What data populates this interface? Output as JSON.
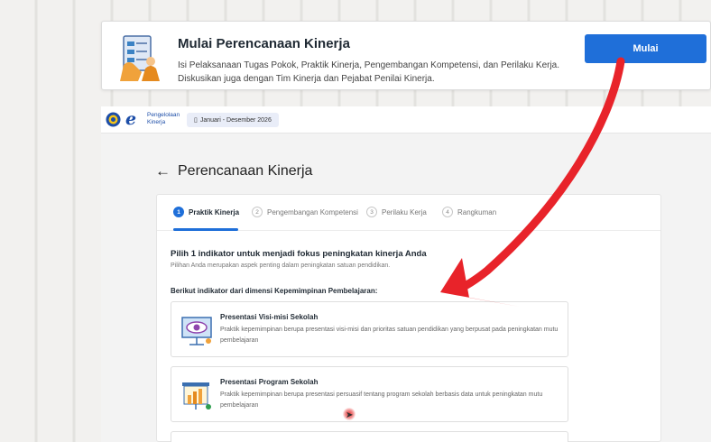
{
  "banner": {
    "title": "Mulai Perencanaan Kinerja",
    "desc_line1": "Isi Pelaksanaan Tugas Pokok, Praktik Kinerja, Pengembangan Kompetensi, dan Perilaku Kerja.",
    "desc_line2": "Diskusikan juga dengan Tim Kinerja dan Pejabat Penilai Kinerja.",
    "button_label": "Mulai"
  },
  "app": {
    "logo_line1": "Pengelolaan",
    "logo_line2": "Kinerja",
    "date_range": "Januari - Desember 2026"
  },
  "page": {
    "title": "Perencanaan Kinerja",
    "back_icon": "←"
  },
  "tabs": [
    {
      "num": "1",
      "label": "Praktik Kinerja",
      "active": true
    },
    {
      "num": "2",
      "label": "Pengembangan Kompetensi",
      "active": false
    },
    {
      "num": "3",
      "label": "Perilaku Kerja",
      "active": false
    },
    {
      "num": "4",
      "label": "Rangkuman",
      "active": false
    }
  ],
  "section": {
    "title": "Pilih 1 indikator untuk menjadi fokus peningkatan kinerja Anda",
    "subtitle": "Pilihan Anda merupakan aspek penting dalam peningkatan satuan pendidikan.",
    "dimension_label": "Berikut indikator dari dimensi Kepemimpinan Pembelajaran:"
  },
  "options": [
    {
      "title": "Presentasi Visi-misi Sekolah",
      "desc": "Praktik kepemimpinan berupa presentasi visi-misi dan prioritas satuan pendidikan yang berpusat pada peningkatan mutu pembelajaran",
      "icon": "presentation-eye-icon"
    },
    {
      "title": "Presentasi Program Sekolah",
      "desc": "Praktik kepemimpinan berupa presentasi persuasif tentang program sekolah berbasis data untuk peningkatan mutu pembelajaran",
      "icon": "presentation-chart-icon"
    }
  ],
  "colors": {
    "accent": "#1f6fd9",
    "annotation_arrow": "#e8232a"
  }
}
